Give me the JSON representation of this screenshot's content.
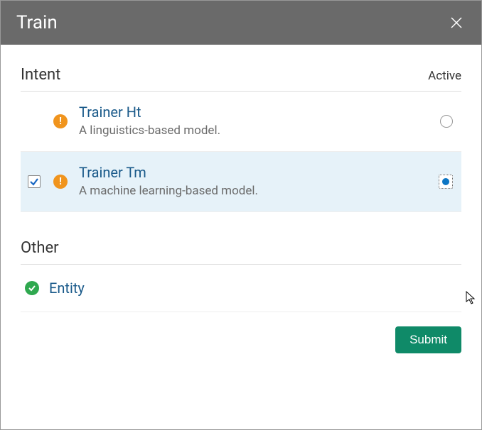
{
  "dialog": {
    "title": "Train"
  },
  "sections": {
    "intent": {
      "title": "Intent",
      "active_label": "Active",
      "items": [
        {
          "title": "Trainer Ht",
          "desc": "A linguistics-based model.",
          "status": "warning",
          "checked": false,
          "active": false
        },
        {
          "title": "Trainer Tm",
          "desc": "A machine learning-based model.",
          "status": "warning",
          "checked": true,
          "active": true
        }
      ]
    },
    "other": {
      "title": "Other",
      "items": [
        {
          "title": "Entity",
          "status": "ok"
        }
      ]
    }
  },
  "buttons": {
    "submit": "Submit"
  }
}
